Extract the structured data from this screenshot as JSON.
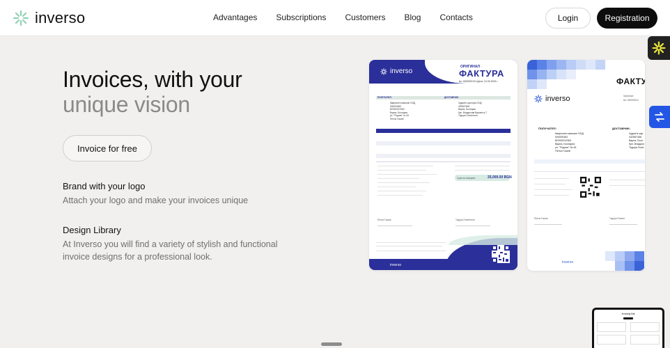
{
  "brand": {
    "name": "inverso",
    "accent": "#8fd1b5"
  },
  "nav": {
    "items": [
      "Advantages",
      "Subscriptions",
      "Customers",
      "Blog",
      "Contacts"
    ],
    "login_label": "Login",
    "registration_label": "Registration"
  },
  "hero": {
    "title_line1": "Invoices, with your",
    "title_line2": "unique vision",
    "cta_label": "Invoice for free"
  },
  "features": [
    {
      "title": "Brand with your logo",
      "desc": "Attach your logo and make your invoices unique"
    },
    {
      "title": "Design Library",
      "desc": "At Inverso you will find a variety of stylish and functional invoice designs for a professional look."
    }
  ],
  "invoice1": {
    "logo": "inverso",
    "original_label": "ОРИГИНАЛ",
    "title": "ФАКТУРА",
    "number": "№: 0000000124 Дата: 10.03.2024 г.",
    "recipient_label": "ПОЛУЧАТЕЛ:",
    "supplier_label": "ДОСТАВЧИК:",
    "recipient": "Квартален магазин ООД\n000000363\nBG000012363\nВарна, България\nул. \"Родопи\" № 26\nПенчо Гошев",
    "supplier": "Чудните кортофи ООД\n432567456\nВарна, България\nбул. Владислав Варненчо 7\nТодора Полетнела",
    "total_label": "Сума за плащане:",
    "total_value": "25,000.00 BGN",
    "signer1": "Пенчо Гошев",
    "signer2": "Тодора Полетнела",
    "footer": "inverso",
    "colors": {
      "primary": "#2a2f9a",
      "mint": "#d7ebe3"
    }
  },
  "invoice2": {
    "logo": "inverso",
    "title": "ФАКТУРА",
    "original_label": "Оригинал",
    "number": "No: 000000012",
    "recipient_label": "ПОЛУЧАТЕЛ:",
    "supplier_label": "ДОСТАВЧИК:",
    "recipient": "Квартален магазин ООД\n000000363\nBG000012363\nВарна, България\nул. \"Родопи\" № 26\nПенчо Гошев",
    "supplier": "Чудните кар\n432567456\nВарна, Бълг\nбул. Владисл\nТодора Поле",
    "signer1": "Пенчо Гошев",
    "signer2": "Тодора Полетн",
    "footer": "inverso",
    "colors": {
      "primary": "#3a63d8"
    }
  },
  "thumbnail": {
    "title": "Invoicing that"
  }
}
